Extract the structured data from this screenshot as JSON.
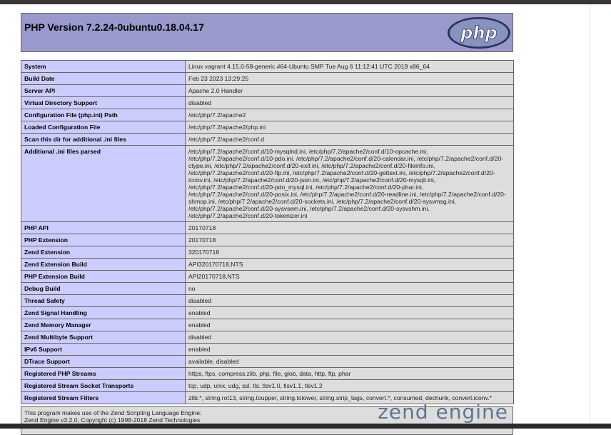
{
  "header": {
    "title": "PHP Version 7.2.24-0ubuntu0.18.04.17",
    "logo_text": "php"
  },
  "rows": [
    {
      "label": "System",
      "value": "Linux vagrant 4.15.0-58-generic #64-Ubuntu SMP Tue Aug 6 11:12:41 UTC 2019 x86_64"
    },
    {
      "label": "Build Date",
      "value": "Feb 23 2023 13:29:25"
    },
    {
      "label": "Server API",
      "value": "Apache 2.0 Handler"
    },
    {
      "label": "Virtual Directory Support",
      "value": "disabled"
    },
    {
      "label": "Configuration File (php.ini) Path",
      "value": "/etc/php/7.2/apache2"
    },
    {
      "label": "Loaded Configuration File",
      "value": "/etc/php/7.2/apache2/php.ini"
    },
    {
      "label": "Scan this dir for additional .ini files",
      "value": "/etc/php/7.2/apache2/conf.d"
    },
    {
      "label": "Additional .ini files parsed",
      "value": "/etc/php/7.2/apache2/conf.d/10-mysqlnd.ini, /etc/php/7.2/apache2/conf.d/10-opcache.ini, /etc/php/7.2/apache2/conf.d/10-pdo.ini, /etc/php/7.2/apache2/conf.d/20-calendar.ini, /etc/php/7.2/apache2/conf.d/20-ctype.ini, /etc/php/7.2/apache2/conf.d/20-exif.ini, /etc/php/7.2/apache2/conf.d/20-fileinfo.ini, /etc/php/7.2/apache2/conf.d/20-ftp.ini, /etc/php/7.2/apache2/conf.d/20-gettext.ini, /etc/php/7.2/apache2/conf.d/20-iconv.ini, /etc/php/7.2/apache2/conf.d/20-json.ini, /etc/php/7.2/apache2/conf.d/20-mysqli.ini, /etc/php/7.2/apache2/conf.d/20-pdo_mysql.ini, /etc/php/7.2/apache2/conf.d/20-phar.ini, /etc/php/7.2/apache2/conf.d/20-posix.ini, /etc/php/7.2/apache2/conf.d/20-readline.ini, /etc/php/7.2/apache2/conf.d/20-shmop.ini, /etc/php/7.2/apache2/conf.d/20-sockets.ini, /etc/php/7.2/apache2/conf.d/20-sysvmsg.ini, /etc/php/7.2/apache2/conf.d/20-sysvsem.ini, /etc/php/7.2/apache2/conf.d/20-sysvshm.ini, /etc/php/7.2/apache2/conf.d/20-tokenizer.ini"
    },
    {
      "label": "PHP API",
      "value": "20170718"
    },
    {
      "label": "PHP Extension",
      "value": "20170718"
    },
    {
      "label": "Zend Extension",
      "value": "320170718"
    },
    {
      "label": "Zend Extension Build",
      "value": "API320170718,NTS"
    },
    {
      "label": "PHP Extension Build",
      "value": "API20170718,NTS"
    },
    {
      "label": "Debug Build",
      "value": "no"
    },
    {
      "label": "Thread Safety",
      "value": "disabled"
    },
    {
      "label": "Zend Signal Handling",
      "value": "enabled"
    },
    {
      "label": "Zend Memory Manager",
      "value": "enabled"
    },
    {
      "label": "Zend Multibyte Support",
      "value": "disabled"
    },
    {
      "label": "IPv6 Support",
      "value": "enabled"
    },
    {
      "label": "DTrace Support",
      "value": "available, disabled"
    },
    {
      "label": "Registered PHP Streams",
      "value": "https, ftps, compress.zlib, php, file, glob, data, http, ftp, phar"
    },
    {
      "label": "Registered Stream Socket Transports",
      "value": "tcp, udp, unix, udg, ssl, tls, tlsv1.0, tlsv1.1, tlsv1.2"
    },
    {
      "label": "Registered Stream Filters",
      "value": "zlib.*, string.rot13, string.toupper, string.tolower, string.strip_tags, convert.*, consumed, dechunk, convert.iconv.*"
    }
  ],
  "zend": {
    "line1": "This program makes use of the Zend Scripting Language Engine:",
    "line2": "Zend Engine v3.2.0, Copyright (c) 1998-2018 Zend Technologies",
    "logo_text": "zend engine"
  },
  "colors": {
    "header_bg": "#9999cc",
    "label_bg": "#ccccff",
    "value_bg": "#dddddd"
  }
}
